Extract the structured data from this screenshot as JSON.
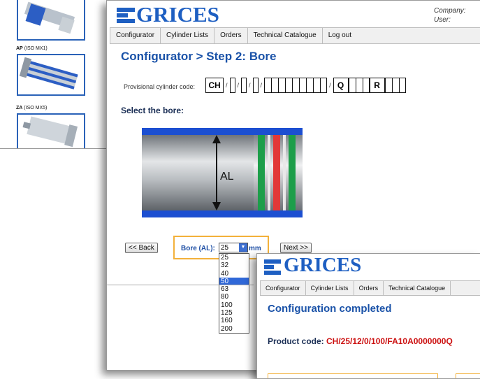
{
  "catalogue": {
    "items": [
      {
        "code": "AP",
        "standard": "(ISO MX1)"
      },
      {
        "code": "ZA",
        "standard": "(ISO MX5)"
      }
    ]
  },
  "brand": "GRICES",
  "user_info": {
    "company_label": "Company:",
    "user_label": "User:"
  },
  "nav": {
    "tabs": [
      "Configurator",
      "Cylinder Lists",
      "Orders",
      "Technical Catalogue",
      "Log out"
    ]
  },
  "configurator": {
    "title": "Configurator > Step 2: Bore",
    "provisional_label": "Provisional cylinder code:",
    "code_prefix": "CH",
    "code_q": "Q",
    "code_r": "R",
    "select_heading": "Select the bore:",
    "diagram_label": "AL",
    "back_label": "<< Back",
    "bore_label": "Bore (AL):",
    "bore_value": "25",
    "bore_unit": "mm",
    "next_label": "Next >>",
    "bore_options": [
      "25",
      "32",
      "40",
      "50",
      "63",
      "80",
      "100",
      "125",
      "160",
      "200"
    ],
    "highlighted_option": "50"
  },
  "completion": {
    "nav_tabs": [
      "Configurator",
      "Cylinder Lists",
      "Orders",
      "Technical Catalogue"
    ],
    "title": "Configuration completed",
    "product_label": "Product code:",
    "product_value": "CH/25/12/0/100/FA10A0000000Q"
  },
  "colors": {
    "brand_blue": "#1e5fc2",
    "accent_orange": "#f3b13a",
    "product_red": "#cc1010"
  }
}
